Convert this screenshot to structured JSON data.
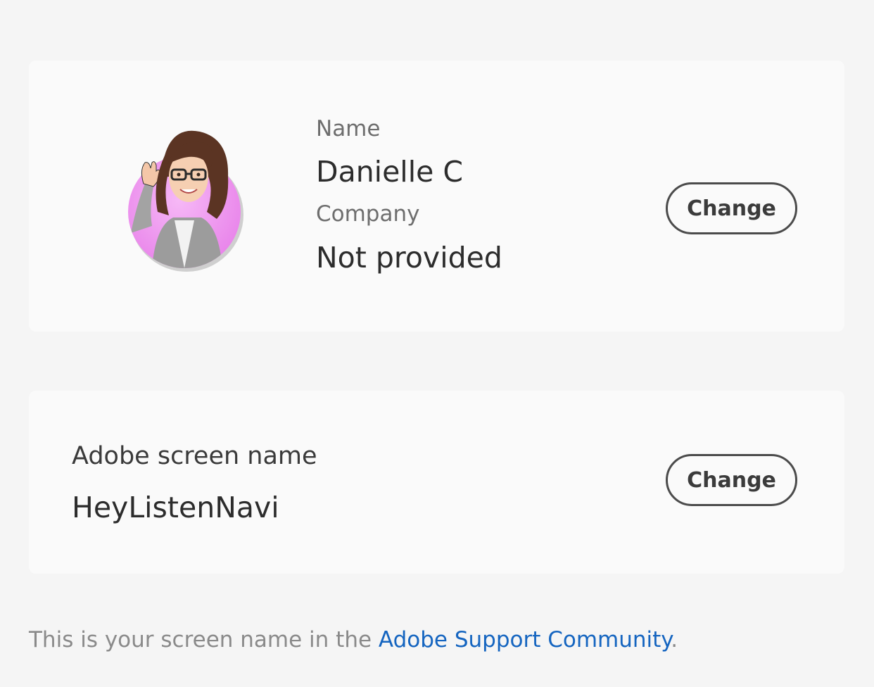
{
  "profile": {
    "avatar_icon": "memoji-avatar-icon",
    "name_label": "Name",
    "name_value": "Danielle C",
    "company_label": "Company",
    "company_value": "Not provided",
    "change_label": "Change"
  },
  "screen_name": {
    "label": "Adobe screen name",
    "value": "HeyListenNavi",
    "change_label": "Change"
  },
  "footer": {
    "prefix": "This is your screen name in the ",
    "link_text": "Adobe Support Community",
    "suffix": "."
  },
  "colors": {
    "background": "#f5f5f5",
    "card": "#fafafa",
    "link": "#1565c0",
    "avatar_ring": "#ee8ef0"
  }
}
